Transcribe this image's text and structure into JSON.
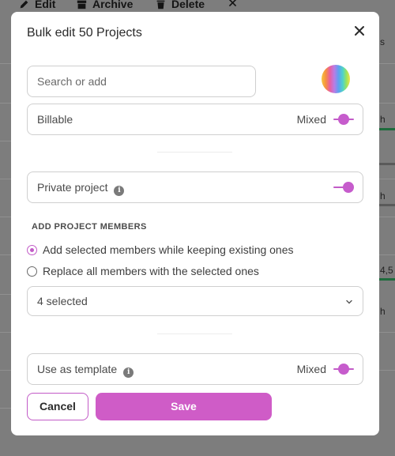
{
  "background": {
    "toolbar": {
      "edit_label": "Edit",
      "archive_label": "Archive",
      "delete_label": "Delete"
    },
    "right_fragments": [
      "s",
      "h",
      "h",
      "4,5",
      "h"
    ]
  },
  "modal": {
    "title": "Bulk edit 50 Projects",
    "search": {
      "placeholder": "Search or add",
      "value": ""
    },
    "billable": {
      "label": "Billable",
      "state_text": "Mixed"
    },
    "private_project": {
      "label": "Private project"
    },
    "members": {
      "section_label": "ADD PROJECT MEMBERS",
      "options": [
        {
          "label": "Add selected members while keeping existing ones",
          "checked": true
        },
        {
          "label": "Replace all members with the selected ones",
          "checked": false
        }
      ],
      "select_value": "4 selected"
    },
    "template": {
      "label": "Use as template",
      "state_text": "Mixed"
    },
    "buttons": {
      "cancel": "Cancel",
      "save": "Save"
    }
  },
  "colors": {
    "accent": "#c25bc7",
    "save_button": "#cf5cc7",
    "overlay": "#7d7d7d"
  },
  "icons": [
    "pencil-icon",
    "archive-icon",
    "trash-icon",
    "close-icon",
    "info-icon",
    "chevron-down-icon"
  ]
}
